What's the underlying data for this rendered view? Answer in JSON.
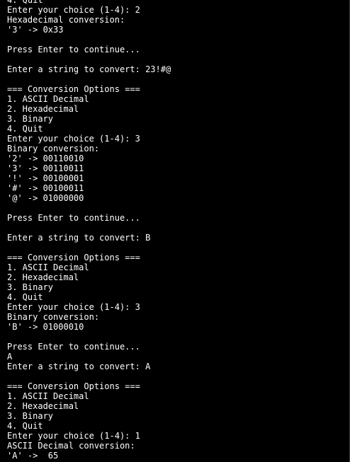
{
  "terminal": {
    "lines": [
      "4. Quit",
      "Enter your choice (1-4): 2",
      "Hexadecimal conversion:",
      "'3' -> 0x33",
      "",
      "Press Enter to continue...",
      "",
      "Enter a string to convert: 23!#@",
      "",
      "=== Conversion Options ===",
      "1. ASCII Decimal",
      "2. Hexadecimal",
      "3. Binary",
      "4. Quit",
      "Enter your choice (1-4): 3",
      "Binary conversion:",
      "'2' -> 00110010",
      "'3' -> 00110011",
      "'!' -> 00100001",
      "'#' -> 00100011",
      "'@' -> 01000000",
      "",
      "Press Enter to continue...",
      "",
      "Enter a string to convert: B",
      "",
      "=== Conversion Options ===",
      "1. ASCII Decimal",
      "2. Hexadecimal",
      "3. Binary",
      "4. Quit",
      "Enter your choice (1-4): 3",
      "Binary conversion:",
      "'B' -> 01000010",
      "",
      "Press Enter to continue...",
      "A",
      "Enter a string to convert: A",
      "",
      "=== Conversion Options ===",
      "1. ASCII Decimal",
      "2. Hexadecimal",
      "3. Binary",
      "4. Quit",
      "Enter your choice (1-4): 1",
      "ASCII Decimal conversion:",
      "'A' ->  65"
    ]
  },
  "colors": {
    "background": "#000000",
    "foreground": "#ffffff"
  }
}
